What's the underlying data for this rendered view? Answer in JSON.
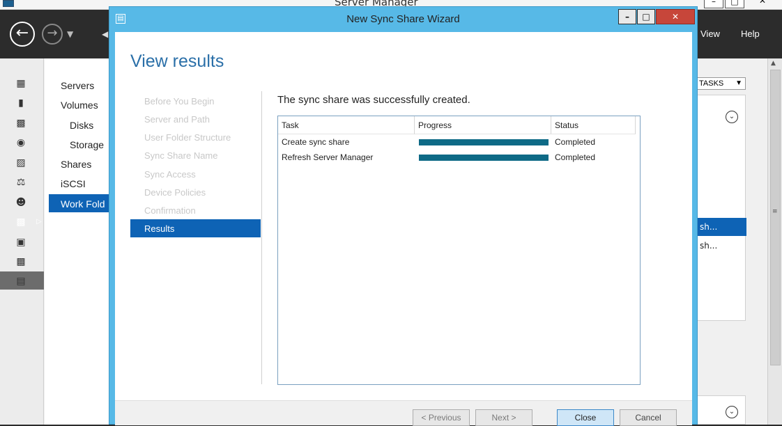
{
  "server_manager": {
    "title": "Server Manager",
    "menu": {
      "view": "View",
      "help": "Help"
    },
    "nav": {
      "items": [
        "Servers",
        "Volumes",
        "Disks",
        "Storage",
        "Shares",
        "iSCSI",
        "Work Fold"
      ]
    },
    "right": {
      "tasks_label": "TASKS",
      "row_selected": "sh...",
      "row_2": "sh..."
    }
  },
  "wizard": {
    "title": "New Sync Share Wizard",
    "heading": "View results",
    "steps": [
      "Before You Begin",
      "Server and Path",
      "User Folder Structure",
      "Sync Share Name",
      "Sync Access",
      "Device Policies",
      "Confirmation",
      "Results"
    ],
    "active_step": "Results",
    "result_message": "The sync share was successfully created.",
    "table": {
      "columns": [
        "Task",
        "Progress",
        "Status"
      ],
      "rows": [
        {
          "task": "Create sync share",
          "progress": 1.0,
          "status": "Completed"
        },
        {
          "task": "Refresh Server Manager",
          "progress": 1.0,
          "status": "Completed"
        }
      ]
    },
    "buttons": {
      "previous": "< Previous",
      "next": "Next >",
      "close": "Close",
      "cancel": "Cancel"
    }
  },
  "colors": {
    "accent": "#0e63b5",
    "wizard_border": "#57b9e7",
    "progress": "#0e6a86",
    "heading": "#2a6fa8"
  }
}
